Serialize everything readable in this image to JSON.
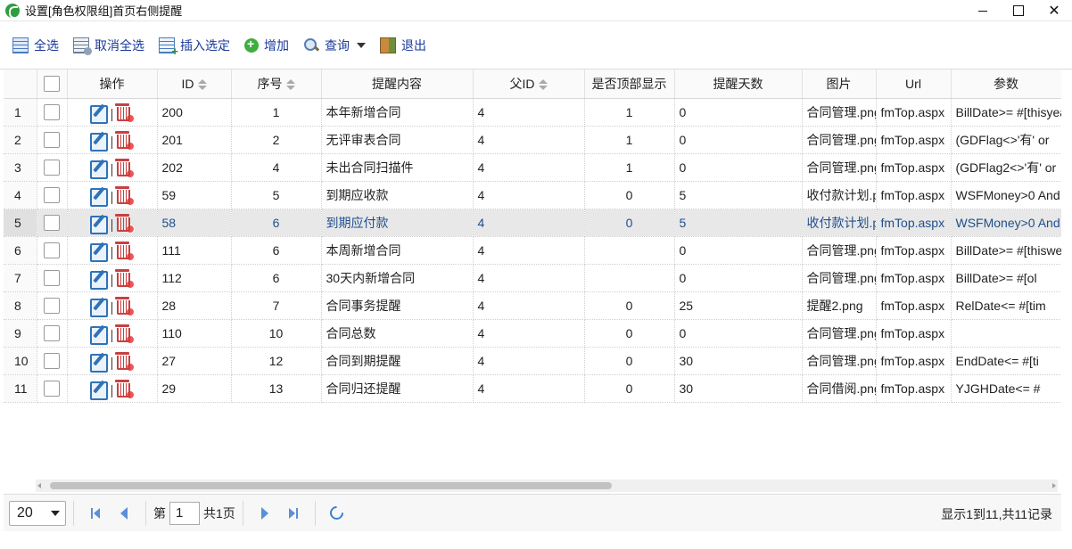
{
  "window": {
    "title": "设置[角色权限组]首页右侧提醒"
  },
  "toolbar": {
    "select_all": "全选",
    "cancel_select_all": "取消全选",
    "insert_selected": "插入选定",
    "add": "增加",
    "query": "查询",
    "exit": "退出"
  },
  "grid": {
    "columns": {
      "ops": "操作",
      "id": "ID",
      "seq": "序号",
      "content": "提醒内容",
      "parent_id": "父ID",
      "show_top": "是否顶部显示",
      "days": "提醒天数",
      "image": "图片",
      "url": "Url",
      "params": "参数"
    },
    "rows": [
      {
        "rn": "1",
        "id": "200",
        "seq": "1",
        "content": "本年新增合同",
        "parent_id": "4",
        "show_top": "1",
        "days": "0",
        "image": "合同管理.png",
        "url": "fmTop.aspx",
        "params": "BillDate>= #[thisyear]#"
      },
      {
        "rn": "2",
        "id": "201",
        "seq": "2",
        "content": "无评审表合同",
        "parent_id": "4",
        "show_top": "1",
        "days": "0",
        "image": "合同管理.png",
        "url": "fmTop.aspx",
        "params": "(GDFlag<>'有' or"
      },
      {
        "rn": "3",
        "id": "202",
        "seq": "4",
        "content": "未出合同扫描件",
        "parent_id": "4",
        "show_top": "1",
        "days": "0",
        "image": "合同管理.png",
        "url": "fmTop.aspx",
        "params": "(GDFlag2<>'有' or"
      },
      {
        "rn": "4",
        "id": "59",
        "seq": "5",
        "content": "到期应收款",
        "parent_id": "4",
        "show_top": "0",
        "days": "5",
        "image": "收付款计划.png",
        "url": "fmTop.aspx",
        "params": "WSFMoney>0 And"
      },
      {
        "rn": "5",
        "id": "58",
        "seq": "6",
        "content": "到期应付款",
        "parent_id": "4",
        "show_top": "0",
        "days": "5",
        "image": "收付款计划.png",
        "url": "fmTop.aspx",
        "params": "WSFMoney>0 And"
      },
      {
        "rn": "6",
        "id": "111",
        "seq": "6",
        "content": "本周新增合同",
        "parent_id": "4",
        "show_top": "",
        "days": "0",
        "image": "合同管理.png",
        "url": "fmTop.aspx",
        "params": "BillDate>= #[thisweek]#"
      },
      {
        "rn": "7",
        "id": "112",
        "seq": "6",
        "content": "30天内新增合同",
        "parent_id": "4",
        "show_top": "",
        "days": "0",
        "image": "合同管理.png",
        "url": "fmTop.aspx",
        "params": "BillDate>= #[ol"
      },
      {
        "rn": "8",
        "id": "28",
        "seq": "7",
        "content": "合同事务提醒",
        "parent_id": "4",
        "show_top": "0",
        "days": "25",
        "image": "提醒2.png",
        "url": "fmTop.aspx",
        "params": "RelDate<= #[tim"
      },
      {
        "rn": "9",
        "id": "110",
        "seq": "10",
        "content": "合同总数",
        "parent_id": "4",
        "show_top": "0",
        "days": "0",
        "image": "合同管理.png",
        "url": "fmTop.aspx",
        "params": ""
      },
      {
        "rn": "10",
        "id": "27",
        "seq": "12",
        "content": "合同到期提醒",
        "parent_id": "4",
        "show_top": "0",
        "days": "30",
        "image": "合同管理.png",
        "url": "fmTop.aspx",
        "params": "EndDate<= #[ti"
      },
      {
        "rn": "11",
        "id": "29",
        "seq": "13",
        "content": "合同归还提醒",
        "parent_id": "4",
        "show_top": "0",
        "days": "30",
        "image": "合同借阅.png",
        "url": "fmTop.aspx",
        "params": "YJGHDate<= #"
      }
    ],
    "selected_row": 4
  },
  "pager": {
    "page_size": "20",
    "page_label": "第",
    "page_value": "1",
    "total_pages": "共1页",
    "info": "显示1到11,共11记录"
  }
}
